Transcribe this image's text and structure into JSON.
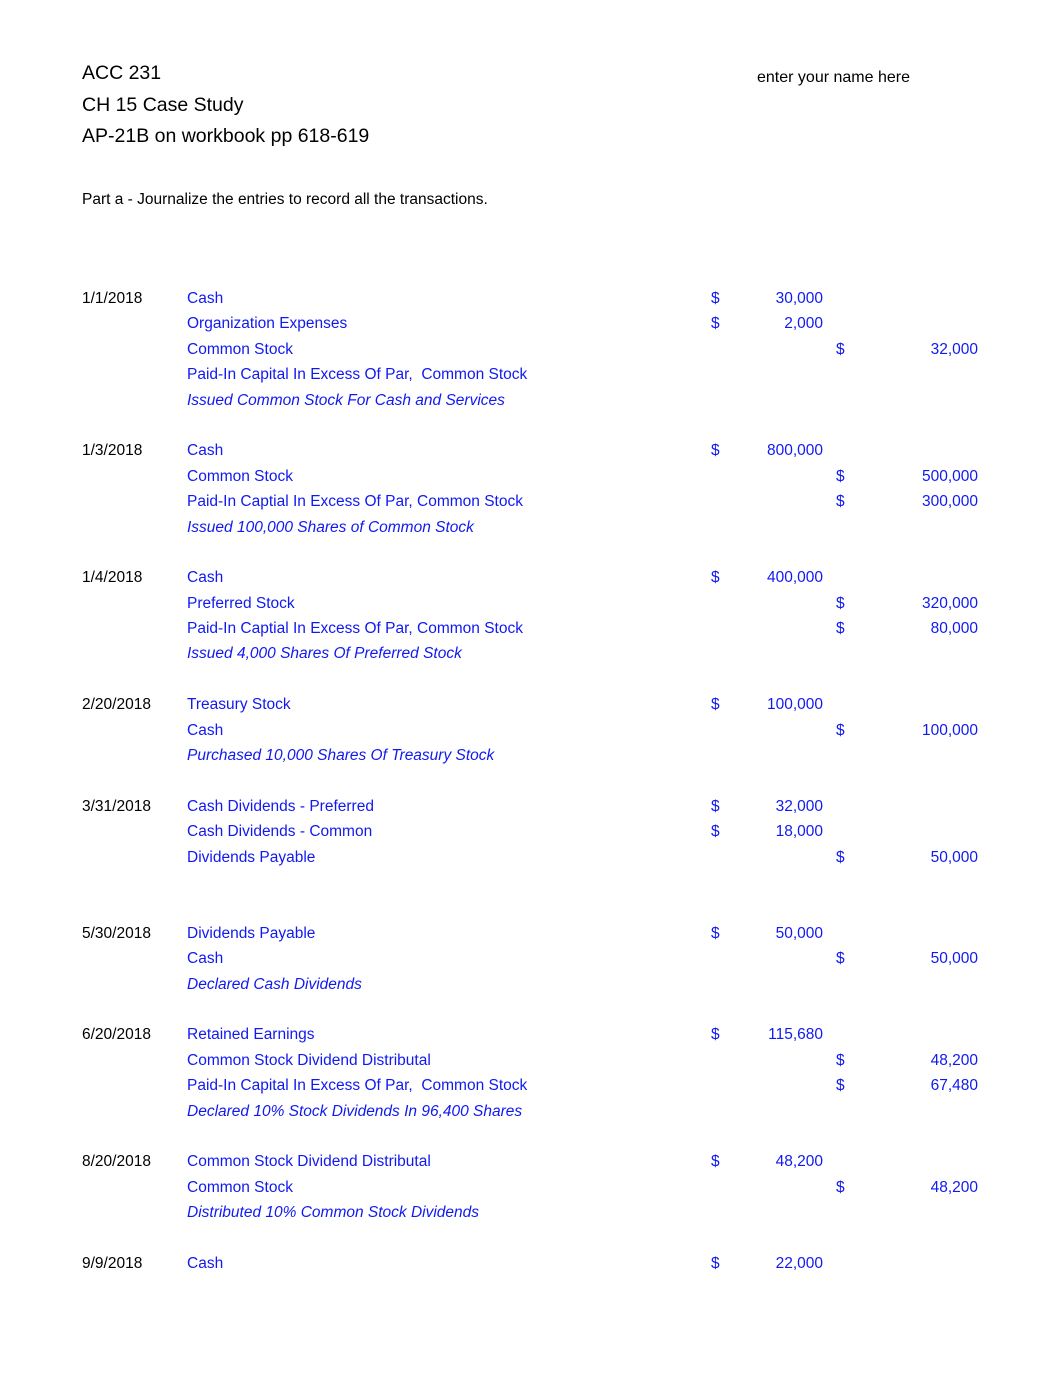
{
  "document": {
    "header_lines": [
      "ACC 231",
      "CH 15 Case Study",
      "AP-21B on workbook pp 618-619"
    ],
    "name_field": "enter your name here",
    "part_label": "Part a - Journalize the entries to record all the transactions.",
    "colors": {
      "entry_text": "#1019f0",
      "header_text": "#000000",
      "page_background": "#ffffff"
    }
  },
  "journal": {
    "rows": [
      {
        "date": "1/1/2018",
        "account": "Cash",
        "italic": false,
        "debit_sym": "$",
        "debit": "30,000",
        "credit_sym": "",
        "credit": ""
      },
      {
        "date": "",
        "account": "Organization Expenses",
        "italic": false,
        "debit_sym": "$",
        "debit": "2,000",
        "credit_sym": "",
        "credit": ""
      },
      {
        "date": "",
        "account": "Common Stock",
        "italic": false,
        "debit_sym": "",
        "debit": "",
        "credit_sym": "$",
        "credit": "32,000"
      },
      {
        "date": "",
        "account": "Paid-In Capital In Excess Of Par,  Common Stock",
        "italic": false,
        "debit_sym": "",
        "debit": "",
        "credit_sym": "",
        "credit": ""
      },
      {
        "date": "",
        "account": "Issued Common Stock For Cash and Services",
        "italic": true,
        "debit_sym": "",
        "debit": "",
        "credit_sym": "",
        "credit": ""
      },
      {
        "date": "",
        "account": "",
        "italic": false,
        "debit_sym": "",
        "debit": "",
        "credit_sym": "",
        "credit": ""
      },
      {
        "date": "1/3/2018",
        "account": "Cash",
        "italic": false,
        "debit_sym": "$",
        "debit": "800,000",
        "credit_sym": "",
        "credit": ""
      },
      {
        "date": "",
        "account": "Common Stock",
        "italic": false,
        "debit_sym": "",
        "debit": "",
        "credit_sym": "$",
        "credit": "500,000"
      },
      {
        "date": "",
        "account": "Paid-In Captial In Excess Of Par, Common Stock",
        "italic": false,
        "debit_sym": "",
        "debit": "",
        "credit_sym": "$",
        "credit": "300,000"
      },
      {
        "date": "",
        "account": "Issued 100,000 Shares of Common Stock",
        "italic": true,
        "debit_sym": "",
        "debit": "",
        "credit_sym": "",
        "credit": ""
      },
      {
        "date": "",
        "account": "",
        "italic": false,
        "debit_sym": "",
        "debit": "",
        "credit_sym": "",
        "credit": ""
      },
      {
        "date": "1/4/2018",
        "account": "Cash",
        "italic": false,
        "debit_sym": "$",
        "debit": "400,000",
        "credit_sym": "",
        "credit": ""
      },
      {
        "date": "",
        "account": "Preferred Stock",
        "italic": false,
        "debit_sym": "",
        "debit": "",
        "credit_sym": "$",
        "credit": "320,000"
      },
      {
        "date": "",
        "account": "Paid-In Captial In Excess Of Par, Common Stock",
        "italic": false,
        "debit_sym": "",
        "debit": "",
        "credit_sym": "$",
        "credit": "80,000"
      },
      {
        "date": "",
        "account": "Issued 4,000 Shares Of Preferred Stock",
        "italic": true,
        "debit_sym": "",
        "debit": "",
        "credit_sym": "",
        "credit": ""
      },
      {
        "date": "",
        "account": "",
        "italic": false,
        "debit_sym": "",
        "debit": "",
        "credit_sym": "",
        "credit": ""
      },
      {
        "date": "2/20/2018",
        "account": "Treasury Stock",
        "italic": false,
        "debit_sym": "$",
        "debit": "100,000",
        "credit_sym": "",
        "credit": ""
      },
      {
        "date": "",
        "account": "Cash",
        "italic": false,
        "debit_sym": "",
        "debit": "",
        "credit_sym": "$",
        "credit": "100,000"
      },
      {
        "date": "",
        "account": "Purchased 10,000 Shares Of Treasury Stock",
        "italic": true,
        "debit_sym": "",
        "debit": "",
        "credit_sym": "",
        "credit": ""
      },
      {
        "date": "",
        "account": "",
        "italic": false,
        "debit_sym": "",
        "debit": "",
        "credit_sym": "",
        "credit": ""
      },
      {
        "date": "3/31/2018",
        "account": "Cash Dividends - Preferred",
        "italic": false,
        "debit_sym": "$",
        "debit": "32,000",
        "credit_sym": "",
        "credit": ""
      },
      {
        "date": "",
        "account": "Cash Dividends - Common",
        "italic": false,
        "debit_sym": "$",
        "debit": "18,000",
        "credit_sym": "",
        "credit": ""
      },
      {
        "date": "",
        "account": "Dividends Payable",
        "italic": false,
        "debit_sym": "",
        "debit": "",
        "credit_sym": "$",
        "credit": "50,000"
      },
      {
        "date": "",
        "account": "",
        "italic": false,
        "debit_sym": "",
        "debit": "",
        "credit_sym": "",
        "credit": ""
      },
      {
        "date": "",
        "account": "",
        "italic": false,
        "debit_sym": "",
        "debit": "",
        "credit_sym": "",
        "credit": ""
      },
      {
        "date": "5/30/2018",
        "account": "Dividends Payable",
        "italic": false,
        "debit_sym": "$",
        "debit": "50,000",
        "credit_sym": "",
        "credit": ""
      },
      {
        "date": "",
        "account": "Cash",
        "italic": false,
        "debit_sym": "",
        "debit": "",
        "credit_sym": "$",
        "credit": "50,000"
      },
      {
        "date": "",
        "account": "Declared Cash Dividends",
        "italic": true,
        "debit_sym": "",
        "debit": "",
        "credit_sym": "",
        "credit": ""
      },
      {
        "date": "",
        "account": "",
        "italic": false,
        "debit_sym": "",
        "debit": "",
        "credit_sym": "",
        "credit": ""
      },
      {
        "date": "6/20/2018",
        "account": "Retained Earnings",
        "italic": false,
        "debit_sym": "$",
        "debit": "115,680",
        "credit_sym": "",
        "credit": ""
      },
      {
        "date": "",
        "account": "Common Stock Dividend Distributal",
        "italic": false,
        "debit_sym": "",
        "debit": "",
        "credit_sym": "$",
        "credit": "48,200"
      },
      {
        "date": "",
        "account": "Paid-In Capital In Excess Of Par,  Common Stock",
        "italic": false,
        "debit_sym": "",
        "debit": "",
        "credit_sym": "$",
        "credit": "67,480"
      },
      {
        "date": "",
        "account": "Declared 10% Stock Dividends In 96,400 Shares",
        "italic": true,
        "debit_sym": "",
        "debit": "",
        "credit_sym": "",
        "credit": ""
      },
      {
        "date": "",
        "account": "",
        "italic": false,
        "debit_sym": "",
        "debit": "",
        "credit_sym": "",
        "credit": ""
      },
      {
        "date": "8/20/2018",
        "account": "Common Stock Dividend Distributal",
        "italic": false,
        "debit_sym": "$",
        "debit": "48,200",
        "credit_sym": "",
        "credit": ""
      },
      {
        "date": "",
        "account": "Common Stock",
        "italic": false,
        "debit_sym": "",
        "debit": "",
        "credit_sym": "$",
        "credit": "48,200"
      },
      {
        "date": "",
        "account": "Distributed 10% Common Stock Dividends",
        "italic": true,
        "debit_sym": "",
        "debit": "",
        "credit_sym": "",
        "credit": ""
      },
      {
        "date": "",
        "account": "",
        "italic": false,
        "debit_sym": "",
        "debit": "",
        "credit_sym": "",
        "credit": ""
      },
      {
        "date": "9/9/2018",
        "account": "Cash",
        "italic": false,
        "debit_sym": "$",
        "debit": "22,000",
        "credit_sym": "",
        "credit": ""
      }
    ]
  }
}
